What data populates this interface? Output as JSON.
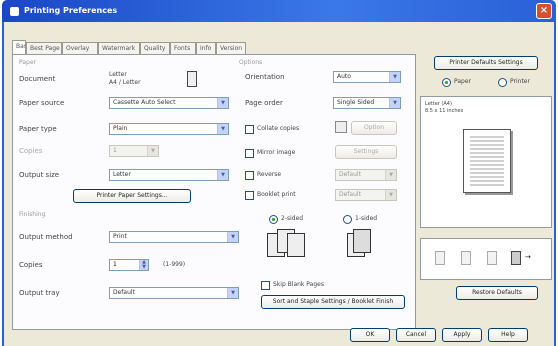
{
  "window": {
    "title": "Printing Preferences",
    "close_glyph": "×"
  },
  "tabs": [
    {
      "label": "Basic"
    },
    {
      "label": "Best Page Setting"
    },
    {
      "label": "Overlay"
    },
    {
      "label": "Watermark"
    },
    {
      "label": "Quality"
    },
    {
      "label": "Fonts"
    },
    {
      "label": "Info"
    },
    {
      "label": "Version"
    }
  ],
  "paper_group": {
    "label": "Paper",
    "rows": [
      {
        "label": "Document",
        "value": "Letter"
      },
      {
        "label": "Output size",
        "value": "A4 / Letter"
      },
      {
        "label": "Paper source",
        "value": "Cassette Auto Select"
      },
      {
        "label": "Copies",
        "value": "1"
      },
      {
        "label": "Paper type",
        "value": "Plain"
      }
    ],
    "button_label": "Printer Paper Settings..."
  },
  "options_group": {
    "label": "Options",
    "rows": [
      {
        "label": "Orientation",
        "value": "Auto"
      },
      {
        "label": "Page order",
        "value": "Single Sided"
      }
    ],
    "checks": [
      {
        "label": "Collate copies",
        "checked": false
      },
      {
        "label": "Mirror image",
        "checked": false
      },
      {
        "label": "Reverse",
        "checked": false
      },
      {
        "label": "Booklet print",
        "checked": false
      }
    ],
    "side_buttons": [
      {
        "label": "Option"
      },
      {
        "label": "Settings"
      },
      {
        "label": "Default"
      },
      {
        "label": "Default"
      }
    ]
  },
  "finishing_group": {
    "label": "Finishing",
    "rows": [
      {
        "label": "Output method",
        "value": "Print"
      },
      {
        "label": "Copies",
        "value": "1"
      },
      {
        "label": "Output tray",
        "value": "Default"
      }
    ],
    "copies_unit": "(1-999)",
    "duplex_label": "2-sided",
    "color_label": "1-sided",
    "checkbox_label": "Skip Blank Pages",
    "wide_button_label": "Sort and Staple Settings / Booklet Finish"
  },
  "preview": {
    "top_button": "Printer Defaults Settings",
    "radio_paper": "Paper",
    "radio_printer": "Printer",
    "caption": "Letter (A4)",
    "caption2": "8.5 x 11 inches",
    "restore_button": "Restore Defaults"
  },
  "footer": {
    "ok": "OK",
    "cancel": "Cancel",
    "apply": "Apply",
    "help": "Help"
  }
}
